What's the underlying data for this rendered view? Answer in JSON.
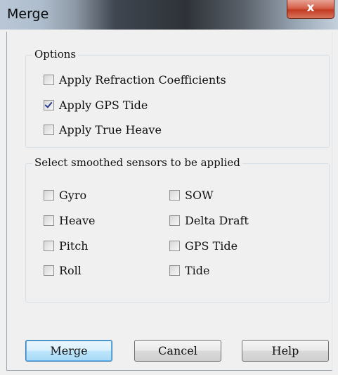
{
  "window": {
    "title": "Merge",
    "close_glyph": "x"
  },
  "options": {
    "legend": "Options",
    "items": [
      {
        "label": "Apply Refraction Coefficients",
        "checked": false
      },
      {
        "label": "Apply GPS Tide",
        "checked": true
      },
      {
        "label": "Apply True Heave",
        "checked": false
      }
    ]
  },
  "sensors": {
    "legend": "Select smoothed sensors to be applied",
    "left": [
      {
        "label": "Gyro",
        "checked": false
      },
      {
        "label": "Heave",
        "checked": false
      },
      {
        "label": "Pitch",
        "checked": false
      },
      {
        "label": "Roll",
        "checked": false
      }
    ],
    "right": [
      {
        "label": "SOW",
        "checked": false
      },
      {
        "label": "Delta Draft",
        "checked": false
      },
      {
        "label": "GPS Tide",
        "checked": false
      },
      {
        "label": "Tide",
        "checked": false
      }
    ]
  },
  "buttons": {
    "merge": "Merge",
    "cancel": "Cancel",
    "help": "Help"
  }
}
